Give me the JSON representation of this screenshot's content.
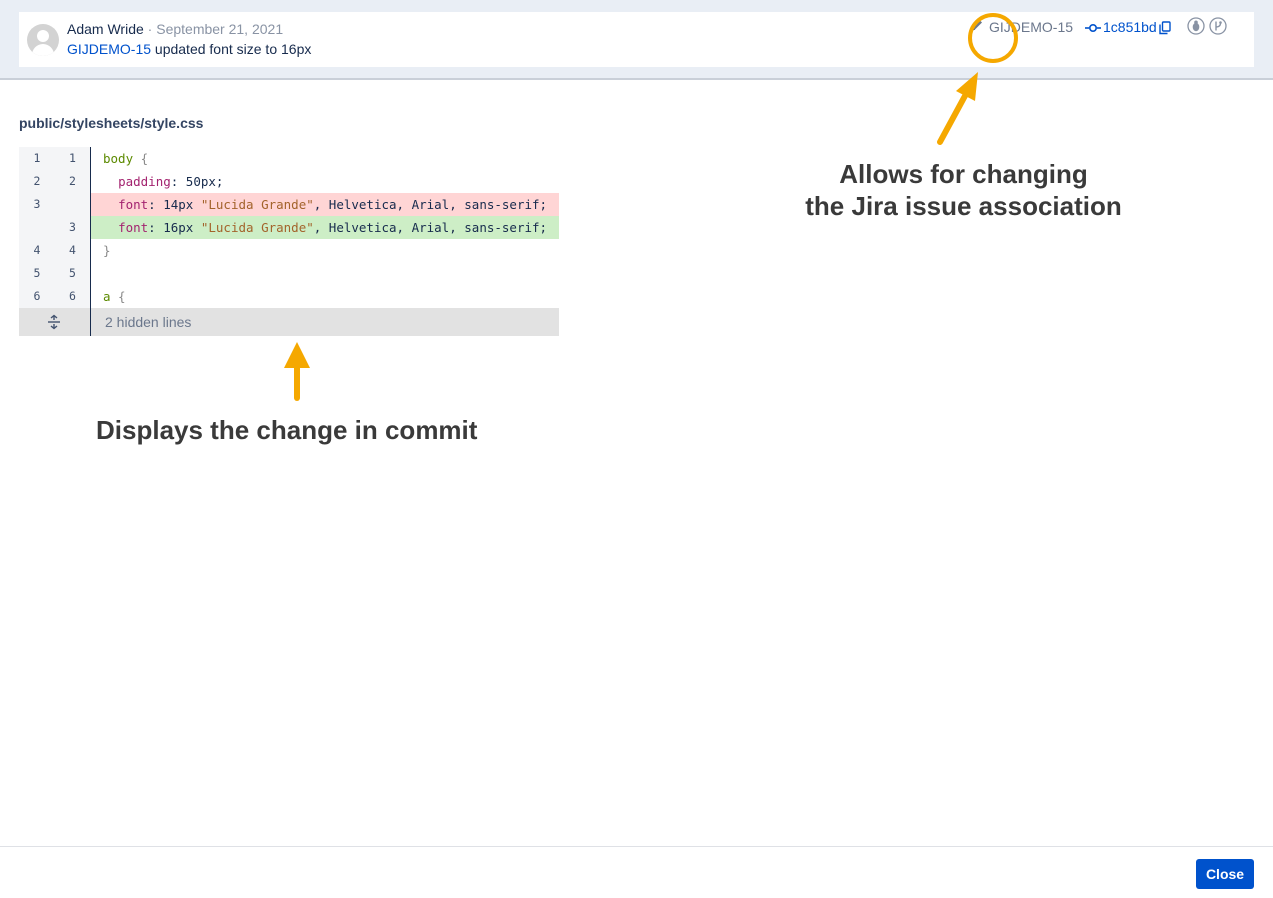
{
  "commit": {
    "author": "Adam Wride",
    "separator": " · ",
    "date": "September 21, 2021",
    "issue_link": "GIJDEMO-15",
    "message": " updated font size to 16px",
    "issue_key": "GIJDEMO-15",
    "hash": "1c851bd"
  },
  "file": {
    "path": "public/stylesheets/style.css"
  },
  "diff": {
    "rows": [
      {
        "old": "1",
        "new": "1",
        "type": "context"
      },
      {
        "old": "2",
        "new": "2",
        "type": "context"
      },
      {
        "old": "3",
        "new": "",
        "type": "removed"
      },
      {
        "old": "",
        "new": "3",
        "type": "added"
      },
      {
        "old": "4",
        "new": "4",
        "type": "context"
      },
      {
        "old": "5",
        "new": "5",
        "type": "context"
      },
      {
        "old": "6",
        "new": "6",
        "type": "context"
      }
    ],
    "code": {
      "line1_selector": "body",
      "line1_brace": " {",
      "line2_prop": "padding",
      "line2_rest": ": 50px;",
      "removed_prop": "font",
      "removed_size": ": 14px ",
      "removed_str": "\"Lucida Grande\"",
      "removed_rest": ", Helvetica, Arial, sans-serif;",
      "added_prop": "font",
      "added_size": ": 16px ",
      "added_str": "\"Lucida Grande\"",
      "added_rest": ", Helvetica, Arial, sans-serif;",
      "line4_brace": "}",
      "line6_selector": "a",
      "line6_brace": " {"
    },
    "hidden_lines_label": "2 hidden lines"
  },
  "annotations": {
    "top_line1": "Allows for changing",
    "top_line2": "the Jira issue association",
    "bottom": "Displays the change in commit",
    "color": "#f5a800"
  },
  "footer": {
    "close_label": "Close"
  },
  "colors": {
    "link": "#0052cc",
    "removed_bg": "#ffd5d5",
    "added_bg": "#cdeec6",
    "primary_button": "#0052cc"
  },
  "icons": [
    "avatar-icon",
    "pencil-icon",
    "commit-icon",
    "copy-icon",
    "bug-icon",
    "branch-icon",
    "expand-icon"
  ]
}
